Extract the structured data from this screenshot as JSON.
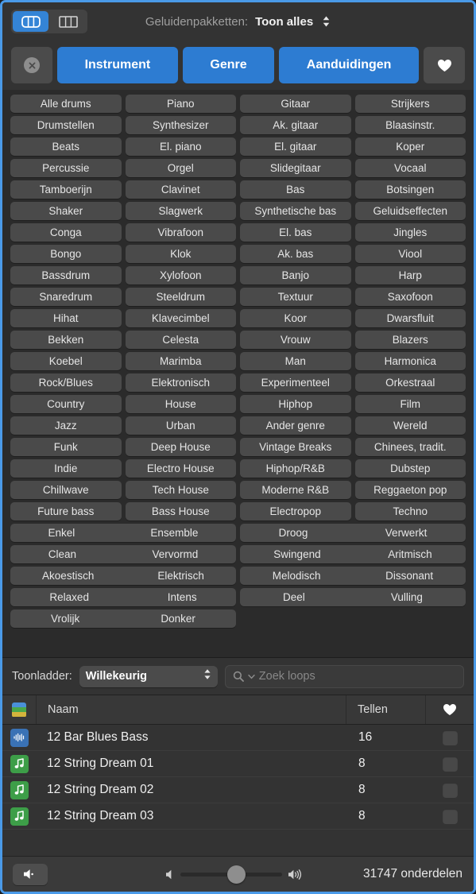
{
  "window": {
    "accent_color": "#4a9ae8",
    "panel_bg": "#2b2b2b"
  },
  "toolbar": {
    "view_buttons": [
      {
        "name": "grid-view",
        "icon": "columns-rounded-icon",
        "active": true
      },
      {
        "name": "list-view",
        "icon": "columns-square-icon",
        "active": false
      }
    ],
    "sound_packs_label": "Geluidenpakketten:",
    "sound_packs_value": "Toon alles"
  },
  "categories": {
    "clear_icon": "clear-circle-icon",
    "buttons": [
      {
        "label": "Instrument",
        "active": true
      },
      {
        "label": "Genre",
        "active": true
      },
      {
        "label": "Aanduidingen",
        "active": true
      }
    ],
    "favorites_icon": "heart-icon"
  },
  "tag_grid": {
    "rows": [
      {
        "span": 1,
        "cells": [
          "Alle drums",
          "Piano",
          "Gitaar",
          "Strijkers"
        ]
      },
      {
        "span": 1,
        "cells": [
          "Drumstellen",
          "Synthesizer",
          "Ak. gitaar",
          "Blaasinstr."
        ]
      },
      {
        "span": 1,
        "cells": [
          "Beats",
          "El. piano",
          "El. gitaar",
          "Koper"
        ]
      },
      {
        "span": 1,
        "cells": [
          "Percussie",
          "Orgel",
          "Slidegitaar",
          "Vocaal"
        ]
      },
      {
        "span": 1,
        "cells": [
          "Tamboerijn",
          "Clavinet",
          "Bas",
          "Botsingen"
        ]
      },
      {
        "span": 1,
        "cells": [
          "Shaker",
          "Slagwerk",
          "Synthetische bas",
          "Geluidseffecten"
        ]
      },
      {
        "span": 1,
        "cells": [
          "Conga",
          "Vibrafoon",
          "El. bas",
          "Jingles"
        ]
      },
      {
        "span": 1,
        "cells": [
          "Bongo",
          "Klok",
          "Ak. bas",
          "Viool"
        ]
      },
      {
        "span": 1,
        "cells": [
          "Bassdrum",
          "Xylofoon",
          "Banjo",
          "Harp"
        ]
      },
      {
        "span": 1,
        "cells": [
          "Snaredrum",
          "Steeldrum",
          "Textuur",
          "Saxofoon"
        ]
      },
      {
        "span": 1,
        "cells": [
          "Hihat",
          "Klavecimbel",
          "Koor",
          "Dwarsfluit"
        ]
      },
      {
        "span": 1,
        "cells": [
          "Bekken",
          "Celesta",
          "Vrouw",
          "Blazers"
        ]
      },
      {
        "span": 1,
        "cells": [
          "Koebel",
          "Marimba",
          "Man",
          "Harmonica"
        ]
      },
      {
        "span": 1,
        "cells": [
          "Rock/Blues",
          "Elektronisch",
          "Experimenteel",
          "Orkestraal"
        ]
      },
      {
        "span": 1,
        "cells": [
          "Country",
          "House",
          "Hiphop",
          "Film"
        ]
      },
      {
        "span": 1,
        "cells": [
          "Jazz",
          "Urban",
          "Ander genre",
          "Wereld"
        ]
      },
      {
        "span": 1,
        "cells": [
          "Funk",
          "Deep House",
          "Vintage Breaks",
          "Chinees, tradit."
        ]
      },
      {
        "span": 1,
        "cells": [
          "Indie",
          "Electro House",
          "Hiphop/R&B",
          "Dubstep"
        ]
      },
      {
        "span": 1,
        "cells": [
          "Chillwave",
          "Tech House",
          "Moderne R&B",
          "Reggaeton pop"
        ]
      },
      {
        "span": 1,
        "cells": [
          "Future bass",
          "Bass House",
          "Electropop",
          "Techno"
        ]
      },
      {
        "span": 2,
        "cells": [
          "Enkel",
          "Ensemble",
          "Droog",
          "Verwerkt"
        ]
      },
      {
        "span": 2,
        "cells": [
          "Clean",
          "Vervormd",
          "Swingend",
          "Aritmisch"
        ]
      },
      {
        "span": 2,
        "cells": [
          "Akoestisch",
          "Elektrisch",
          "Melodisch",
          "Dissonant"
        ]
      },
      {
        "span": 2,
        "cells": [
          "Relaxed",
          "Intens",
          "Deel",
          "Vulling"
        ]
      },
      {
        "span": 2,
        "cells": [
          "Vrolijk",
          "Donker",
          "",
          ""
        ]
      }
    ]
  },
  "filter_bar": {
    "scale_label": "Toonladder:",
    "scale_value": "Willekeurig",
    "search_icon": "search-icon",
    "search_placeholder": "Zoek loops",
    "search_value": ""
  },
  "loop_list": {
    "columns": {
      "icon_header": "color-stripes-icon",
      "name": "Naam",
      "count": "Tellen",
      "favorite_icon": "heart-icon"
    },
    "rows": [
      {
        "icon": "waveform-icon",
        "kind": "audio",
        "name": "12 Bar Blues Bass",
        "count": "16",
        "favorite": false
      },
      {
        "icon": "music-note-icon",
        "kind": "midi",
        "name": "12 String Dream 01",
        "count": "8",
        "favorite": false
      },
      {
        "icon": "music-note-icon",
        "kind": "midi",
        "name": "12 String Dream 02",
        "count": "8",
        "favorite": false
      },
      {
        "icon": "music-note-icon",
        "kind": "midi",
        "name": "12 String Dream 03",
        "count": "8",
        "favorite": false
      }
    ]
  },
  "status_bar": {
    "speaker_icon": "speaker-icon",
    "volume_min_icon": "volume-low-icon",
    "volume_max_icon": "volume-high-icon",
    "volume_percent": 48,
    "items_count_text": "31747 onderdelen"
  }
}
